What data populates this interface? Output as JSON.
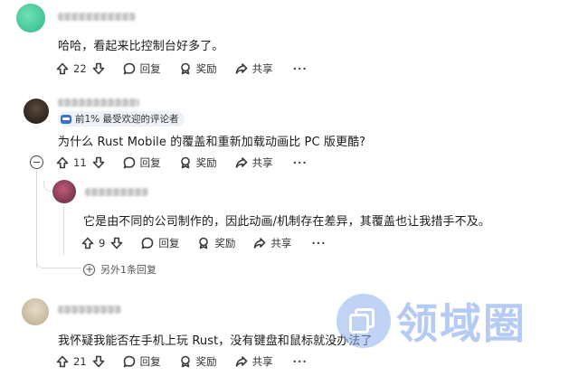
{
  "comments": [
    {
      "text": "哈哈，看起来比控制台好多了。",
      "actions": {
        "upvotes": "22",
        "reply": "回复",
        "award": "奖励",
        "share": "共享",
        "more": "···"
      }
    },
    {
      "badge": "前1% 最受欢迎的评论者",
      "text": "为什么 Rust Mobile 的覆盖和重新加载动画比 PC 版更酷?",
      "actions": {
        "upvotes": "11",
        "reply": "回复",
        "award": "奖励",
        "share": "共享",
        "more": "···"
      },
      "reply": {
        "text": "它是由不同的公司制作的，因此动画/机制存在差异，其覆盖也让我措手不及。",
        "actions": {
          "upvotes": "9",
          "reply": "回复",
          "award": "奖励",
          "share": "共享",
          "more": "···"
        }
      },
      "more_replies": "另外1条回复"
    },
    {
      "text": "我怀疑我能否在手机上玩 Rust，没有键盘和鼠标就没办法了",
      "actions": {
        "upvotes": "21",
        "reply": "回复",
        "award": "奖励",
        "share": "共享",
        "more": "···"
      }
    }
  ],
  "watermark": {
    "text": "领域圈"
  },
  "colors": {
    "badge_bg": "#eef1f6",
    "badge_icon": "#3a6fd8",
    "watermark": "#7aa1ea",
    "thread_line": "#d9dde3"
  }
}
